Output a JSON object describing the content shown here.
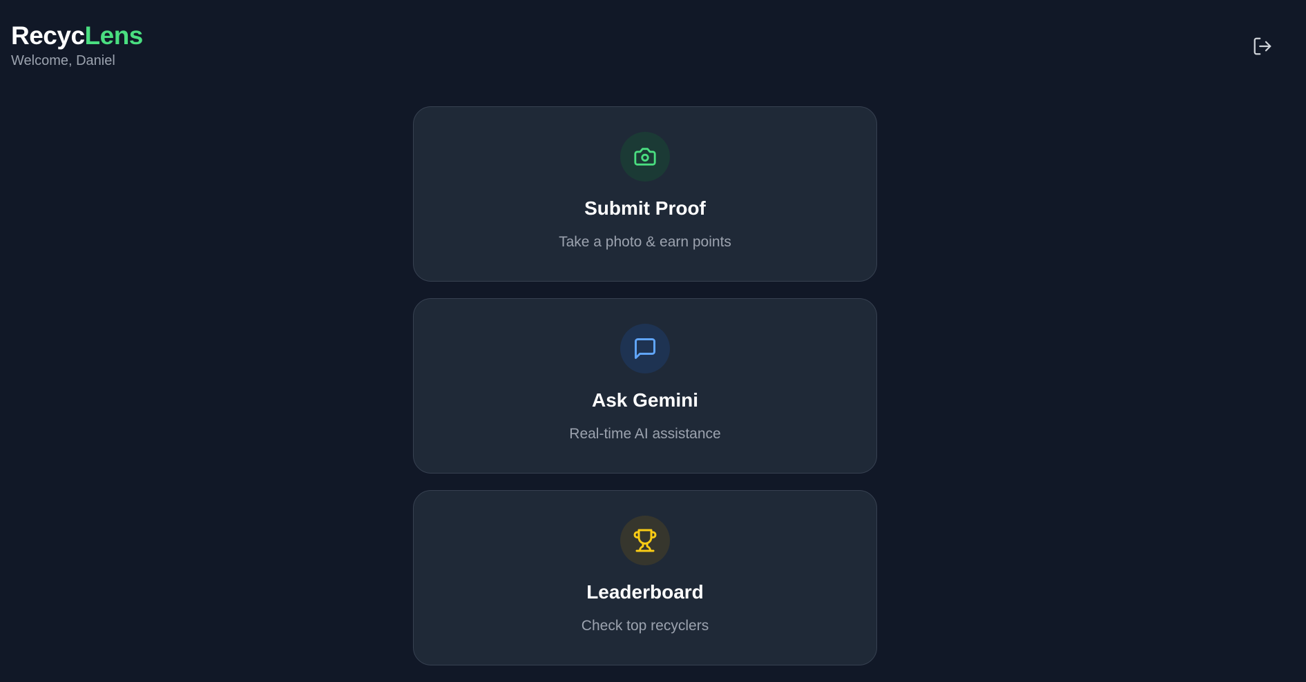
{
  "header": {
    "brand_part_1": "Recyc",
    "brand_part_2": "Lens",
    "welcome": "Welcome, Daniel"
  },
  "logout": {
    "icon": "logout-icon",
    "color": "#d1d5db"
  },
  "colors": {
    "background": "#111827",
    "card": "#1f2937",
    "brand_accent": "#4ade80"
  },
  "cards": [
    {
      "title": "Submit Proof",
      "subtitle": "Take a photo & earn points",
      "icon": "camera-icon",
      "icon_color": "#4ade80"
    },
    {
      "title": "Ask Gemini",
      "subtitle": "Real-time AI assistance",
      "icon": "chat-bubble-icon",
      "icon_color": "#60a5fa"
    },
    {
      "title": "Leaderboard",
      "subtitle": "Check top recyclers",
      "icon": "trophy-icon",
      "icon_color": "#facc15"
    }
  ]
}
